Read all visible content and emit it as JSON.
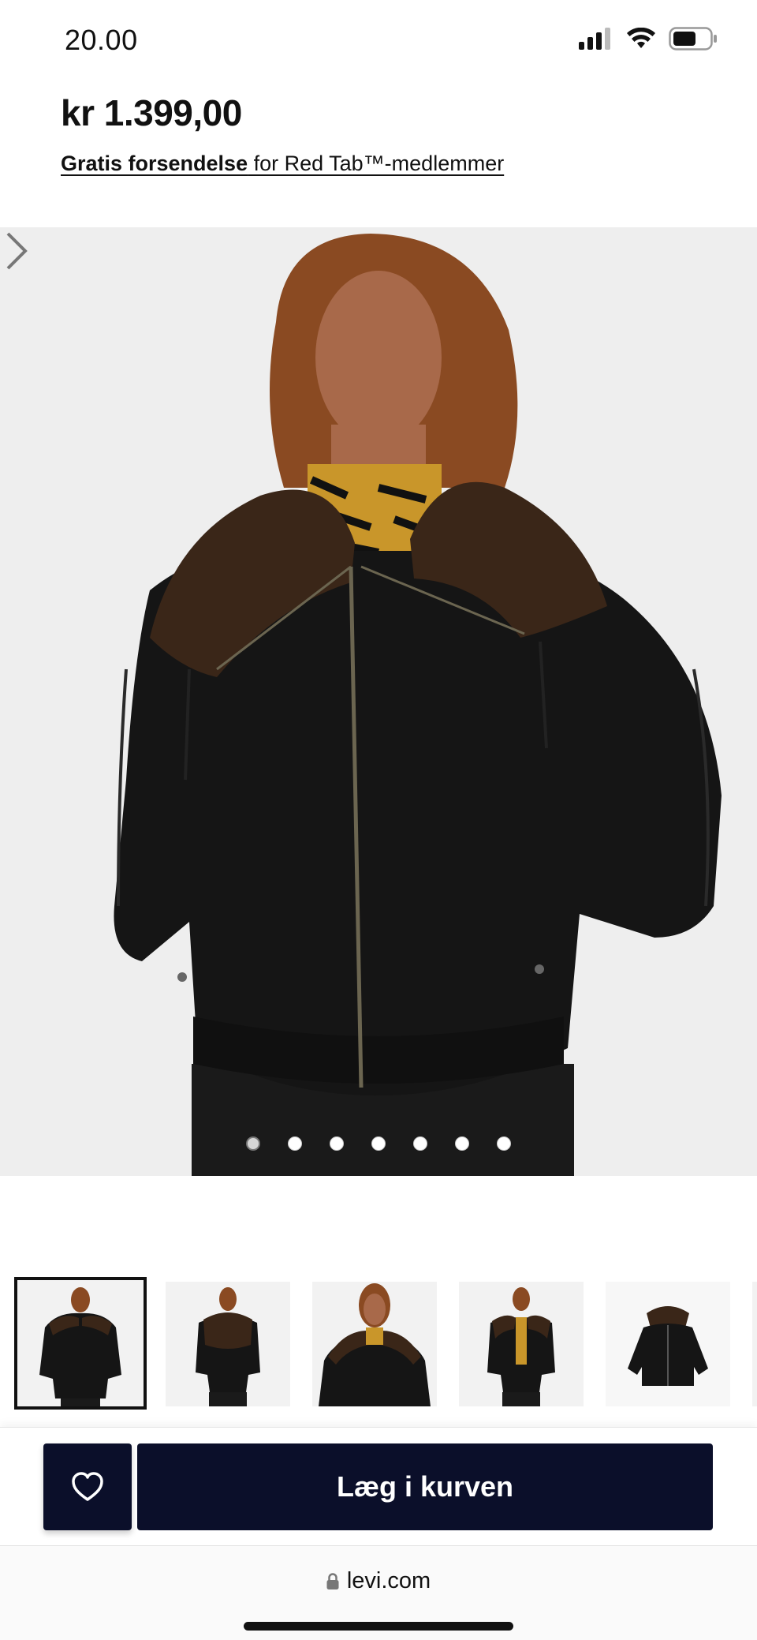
{
  "status_bar": {
    "time": "20.00",
    "icons": [
      "cellular-signal-icon",
      "wifi-icon",
      "battery-icon"
    ]
  },
  "product": {
    "price": "kr 1.399,00",
    "shipping_bold": "Gratis forsendelse",
    "shipping_rest": " for Red Tab™-medlemmer"
  },
  "gallery": {
    "image_count": 7,
    "active_index": 0,
    "next_icon": "chevron-right-icon",
    "thumbnail_count": 5,
    "selected_thumbnail": 0
  },
  "actions": {
    "favorite_icon": "heart-icon",
    "add_to_cart": "Læg i kurven"
  },
  "browser": {
    "lock_icon": "lock-icon",
    "url": "levi.com"
  },
  "colors": {
    "button_navy": "#0b0f2a",
    "image_bg": "#efefef"
  }
}
